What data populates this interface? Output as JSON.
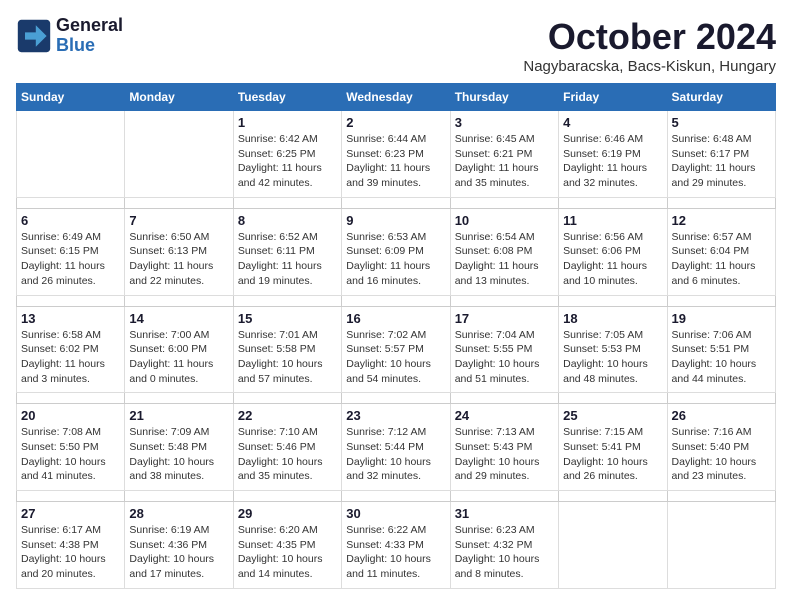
{
  "header": {
    "logo_line1": "General",
    "logo_line2": "Blue",
    "month_title": "October 2024",
    "location": "Nagybaracska, Bacs-Kiskun, Hungary"
  },
  "weekdays": [
    "Sunday",
    "Monday",
    "Tuesday",
    "Wednesday",
    "Thursday",
    "Friday",
    "Saturday"
  ],
  "weeks": [
    [
      {
        "day": "",
        "info": ""
      },
      {
        "day": "",
        "info": ""
      },
      {
        "day": "1",
        "info": "Sunrise: 6:42 AM\nSunset: 6:25 PM\nDaylight: 11 hours and 42 minutes."
      },
      {
        "day": "2",
        "info": "Sunrise: 6:44 AM\nSunset: 6:23 PM\nDaylight: 11 hours and 39 minutes."
      },
      {
        "day": "3",
        "info": "Sunrise: 6:45 AM\nSunset: 6:21 PM\nDaylight: 11 hours and 35 minutes."
      },
      {
        "day": "4",
        "info": "Sunrise: 6:46 AM\nSunset: 6:19 PM\nDaylight: 11 hours and 32 minutes."
      },
      {
        "day": "5",
        "info": "Sunrise: 6:48 AM\nSunset: 6:17 PM\nDaylight: 11 hours and 29 minutes."
      }
    ],
    [
      {
        "day": "6",
        "info": "Sunrise: 6:49 AM\nSunset: 6:15 PM\nDaylight: 11 hours and 26 minutes."
      },
      {
        "day": "7",
        "info": "Sunrise: 6:50 AM\nSunset: 6:13 PM\nDaylight: 11 hours and 22 minutes."
      },
      {
        "day": "8",
        "info": "Sunrise: 6:52 AM\nSunset: 6:11 PM\nDaylight: 11 hours and 19 minutes."
      },
      {
        "day": "9",
        "info": "Sunrise: 6:53 AM\nSunset: 6:09 PM\nDaylight: 11 hours and 16 minutes."
      },
      {
        "day": "10",
        "info": "Sunrise: 6:54 AM\nSunset: 6:08 PM\nDaylight: 11 hours and 13 minutes."
      },
      {
        "day": "11",
        "info": "Sunrise: 6:56 AM\nSunset: 6:06 PM\nDaylight: 11 hours and 10 minutes."
      },
      {
        "day": "12",
        "info": "Sunrise: 6:57 AM\nSunset: 6:04 PM\nDaylight: 11 hours and 6 minutes."
      }
    ],
    [
      {
        "day": "13",
        "info": "Sunrise: 6:58 AM\nSunset: 6:02 PM\nDaylight: 11 hours and 3 minutes."
      },
      {
        "day": "14",
        "info": "Sunrise: 7:00 AM\nSunset: 6:00 PM\nDaylight: 11 hours and 0 minutes."
      },
      {
        "day": "15",
        "info": "Sunrise: 7:01 AM\nSunset: 5:58 PM\nDaylight: 10 hours and 57 minutes."
      },
      {
        "day": "16",
        "info": "Sunrise: 7:02 AM\nSunset: 5:57 PM\nDaylight: 10 hours and 54 minutes."
      },
      {
        "day": "17",
        "info": "Sunrise: 7:04 AM\nSunset: 5:55 PM\nDaylight: 10 hours and 51 minutes."
      },
      {
        "day": "18",
        "info": "Sunrise: 7:05 AM\nSunset: 5:53 PM\nDaylight: 10 hours and 48 minutes."
      },
      {
        "day": "19",
        "info": "Sunrise: 7:06 AM\nSunset: 5:51 PM\nDaylight: 10 hours and 44 minutes."
      }
    ],
    [
      {
        "day": "20",
        "info": "Sunrise: 7:08 AM\nSunset: 5:50 PM\nDaylight: 10 hours and 41 minutes."
      },
      {
        "day": "21",
        "info": "Sunrise: 7:09 AM\nSunset: 5:48 PM\nDaylight: 10 hours and 38 minutes."
      },
      {
        "day": "22",
        "info": "Sunrise: 7:10 AM\nSunset: 5:46 PM\nDaylight: 10 hours and 35 minutes."
      },
      {
        "day": "23",
        "info": "Sunrise: 7:12 AM\nSunset: 5:44 PM\nDaylight: 10 hours and 32 minutes."
      },
      {
        "day": "24",
        "info": "Sunrise: 7:13 AM\nSunset: 5:43 PM\nDaylight: 10 hours and 29 minutes."
      },
      {
        "day": "25",
        "info": "Sunrise: 7:15 AM\nSunset: 5:41 PM\nDaylight: 10 hours and 26 minutes."
      },
      {
        "day": "26",
        "info": "Sunrise: 7:16 AM\nSunset: 5:40 PM\nDaylight: 10 hours and 23 minutes."
      }
    ],
    [
      {
        "day": "27",
        "info": "Sunrise: 6:17 AM\nSunset: 4:38 PM\nDaylight: 10 hours and 20 minutes."
      },
      {
        "day": "28",
        "info": "Sunrise: 6:19 AM\nSunset: 4:36 PM\nDaylight: 10 hours and 17 minutes."
      },
      {
        "day": "29",
        "info": "Sunrise: 6:20 AM\nSunset: 4:35 PM\nDaylight: 10 hours and 14 minutes."
      },
      {
        "day": "30",
        "info": "Sunrise: 6:22 AM\nSunset: 4:33 PM\nDaylight: 10 hours and 11 minutes."
      },
      {
        "day": "31",
        "info": "Sunrise: 6:23 AM\nSunset: 4:32 PM\nDaylight: 10 hours and 8 minutes."
      },
      {
        "day": "",
        "info": ""
      },
      {
        "day": "",
        "info": ""
      }
    ]
  ]
}
